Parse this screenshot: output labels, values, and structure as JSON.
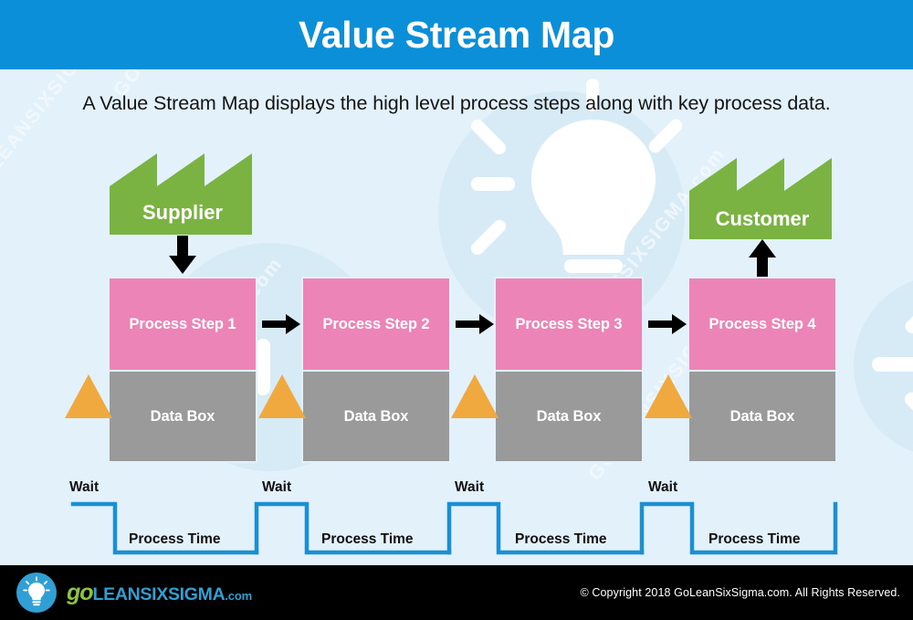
{
  "header": {
    "title": "Value Stream Map",
    "bg_color": "#0a8fd8",
    "text_color": "#ffffff"
  },
  "subtitle": "A Value Stream Map displays the high level process steps along with key process data.",
  "canvas": {
    "bg_color": "#e2f1fa",
    "watermark_text": "GOLEANSIXSIGMA.com"
  },
  "colors": {
    "process_pink": "#ed84b8",
    "data_gray": "#9a9a9a",
    "factory_green": "#7ab342",
    "inventory_orange": "#f0a93e",
    "timeline_blue": "#1a8fd4",
    "arrow_black": "#000000",
    "footer_black": "#000000"
  },
  "endpoints": {
    "supplier": {
      "label": "Supplier",
      "arrow_direction": "down",
      "icon": "factory-icon"
    },
    "customer": {
      "label": "Customer",
      "arrow_direction": "up",
      "icon": "factory-icon"
    }
  },
  "process_steps": [
    {
      "process_label": "Process Step 1",
      "data_label": "Data Box",
      "inventory_icon": "inventory-triangle-icon"
    },
    {
      "process_label": "Process Step 2",
      "data_label": "Data Box",
      "inventory_icon": "inventory-triangle-icon"
    },
    {
      "process_label": "Process Step 3",
      "data_label": "Data Box",
      "inventory_icon": "inventory-triangle-icon"
    },
    {
      "process_label": "Process Step 4",
      "data_label": "Data Box",
      "inventory_icon": "inventory-triangle-icon"
    }
  ],
  "flow_arrows": [
    {
      "icon": "arrow-right-icon"
    },
    {
      "icon": "arrow-right-icon"
    },
    {
      "icon": "arrow-right-icon"
    }
  ],
  "timeline": {
    "segments": [
      {
        "wait_label": "Wait",
        "process_time_label": "Process Time"
      },
      {
        "wait_label": "Wait",
        "process_time_label": "Process Time"
      },
      {
        "wait_label": "Wait",
        "process_time_label": "Process Time"
      },
      {
        "wait_label": "Wait",
        "process_time_label": "Process Time"
      }
    ]
  },
  "footer": {
    "logo": {
      "icon": "lightbulb-icon",
      "go": "go",
      "leansixsigma": "LEANSIXSIGMA",
      "com": ".com"
    },
    "copyright": "© Copyright 2018 GoLeanSixSigma.com. All Rights Reserved."
  }
}
